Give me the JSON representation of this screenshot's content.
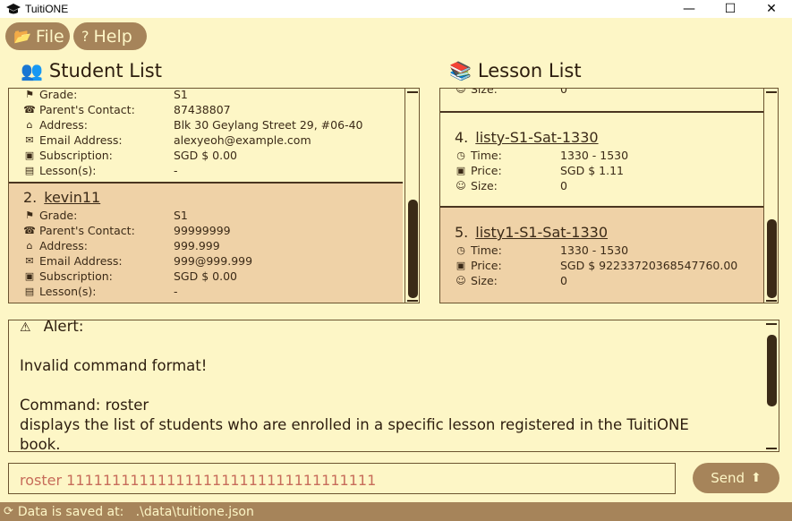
{
  "window": {
    "title": "TuitiONE",
    "minimize": "—",
    "maximize": "☐",
    "close": "✕"
  },
  "menu": {
    "file": "File",
    "help": "Help"
  },
  "students": {
    "heading": "Student List",
    "partial_card": {
      "rows": [
        {
          "label": "Grade:",
          "value": "S1"
        },
        {
          "label": "Parent's Contact:",
          "value": "87438807"
        },
        {
          "label": "Address:",
          "value": "Blk 30 Geylang Street 29, #06-40"
        },
        {
          "label": "Email Address:",
          "value": "alexyeoh@example.com"
        },
        {
          "label": "Subscription:",
          "value": "SGD $ 0.00"
        },
        {
          "label": "Lesson(s):",
          "value": "-"
        }
      ]
    },
    "card2": {
      "index": "2.",
      "name": "kevin11",
      "rows": [
        {
          "label": "Grade:",
          "value": "S1"
        },
        {
          "label": "Parent's Contact:",
          "value": "99999999"
        },
        {
          "label": "Address:",
          "value": "999.999"
        },
        {
          "label": "Email Address:",
          "value": "999@999.999"
        },
        {
          "label": "Subscription:",
          "value": "SGD $ 0.00"
        },
        {
          "label": "Lesson(s):",
          "value": "-"
        }
      ]
    },
    "scroll_position": 0.92
  },
  "lessons": {
    "heading": "Lesson List",
    "partial_label": "Size:",
    "partial_value": "0",
    "card4": {
      "index": "4.",
      "name": "listy-S1-Sat-1330",
      "rows": [
        {
          "label": "Time:",
          "value": "1330 - 1530"
        },
        {
          "label": "Price:",
          "value": "SGD $ 1.11"
        },
        {
          "label": "Size:",
          "value": "0"
        }
      ]
    },
    "card5": {
      "index": "5.",
      "name": "listy1-S1-Sat-1330",
      "rows": [
        {
          "label": "Time:",
          "value": "1330 - 1530"
        },
        {
          "label": "Price:",
          "value": "SGD $ 92233720368547760.00"
        },
        {
          "label": "Size:",
          "value": "0"
        }
      ]
    },
    "scroll_position": 0.95
  },
  "alert": {
    "title": "Alert:",
    "line1": "Invalid command format!",
    "line2": "Command: roster",
    "line3": "displays the list of students who are enrolled in a specific lesson registered in the TuitiONE",
    "line4": "book."
  },
  "command": {
    "value": "roster 1111111111111111111111111111111111"
  },
  "send": {
    "label": "Send"
  },
  "status": {
    "label": "Data is saved at:",
    "path": ".\\data\\tuitione.json"
  }
}
